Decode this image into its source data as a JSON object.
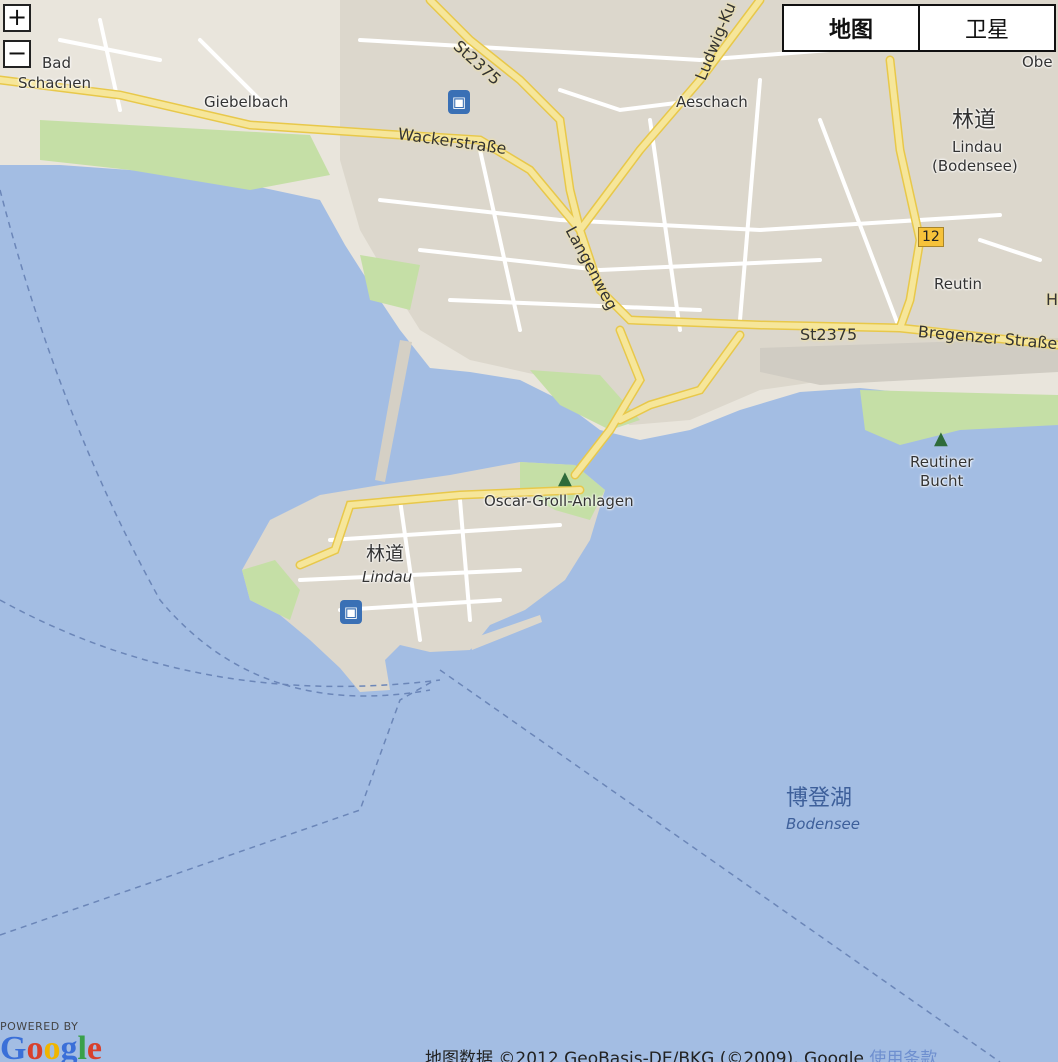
{
  "map_type": {
    "map_label": "地图",
    "satellite_label": "卫星",
    "selected": "map"
  },
  "zoom": {
    "in_label": "+",
    "out_label": "−"
  },
  "places": {
    "bad_schachen_line1": "Bad",
    "bad_schachen_line2": "Schachen",
    "giebelbach": "Giebelbach",
    "aeschach": "Aeschach",
    "lindau_cn_top": "林道",
    "lindau_de_top_line1": "Lindau",
    "lindau_de_top_line2": "(Bodensee)",
    "reutin": "Reutin",
    "obe": "Obe",
    "oscar_groll": "Oscar-Groll-Anlagen",
    "lindau_cn": "林道",
    "lindau_de": "Lindau",
    "reutiner_line1": "Reutiner",
    "reutiner_line2": "Bucht",
    "bodensee_cn": "博登湖",
    "bodensee_de": "Bodensee"
  },
  "roads": {
    "st2375_top": "St2375",
    "ludwig": "Ludwig-Ku",
    "wackerstrasse": "Wackerstraße",
    "langenweg": "Langenweg",
    "st2375_right": "St2375",
    "bregenzer": "Bregenzer Straße",
    "h": "H",
    "route_12": "12"
  },
  "icons": {
    "train": "train-station-icon",
    "park": "park-tree-icon"
  },
  "footer": {
    "powered_by": "POWERED BY",
    "google": "Google",
    "copyright": "地图数据 ©2012 GeoBasis-DE/BKG (©2009), Google",
    "terms": "使用条款"
  },
  "colors": {
    "water": "#a3bde3",
    "land": "#e9e5dc",
    "urban": "#ddd8cd",
    "park": "#c5dfa6",
    "major_road": "#f6e69a",
    "minor_road": "#ffffff"
  }
}
